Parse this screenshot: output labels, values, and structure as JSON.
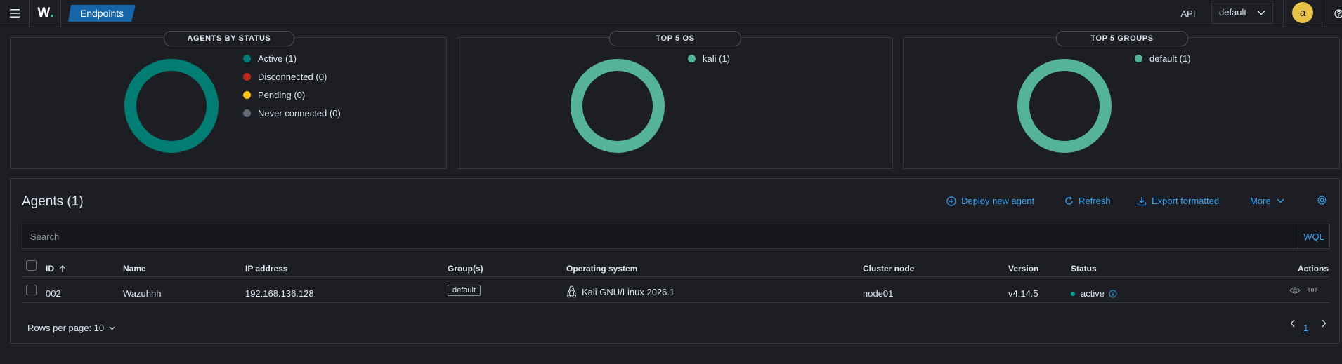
{
  "header": {
    "logo": "W",
    "logo_dot": ".",
    "breadcrumb": "Endpoints",
    "api_label": "API",
    "tenant": "default",
    "avatar_letter": "a"
  },
  "panels": [
    {
      "title": "AGENTS BY STATUS",
      "legend": [
        {
          "label": "Active (1)",
          "color": "#017d73"
        },
        {
          "label": "Disconnected (0)",
          "color": "#bd271e"
        },
        {
          "label": "Pending (0)",
          "color": "#fec514"
        },
        {
          "label": "Never connected (0)",
          "color": "#646a77"
        }
      ],
      "donut_color": "#017d73"
    },
    {
      "title": "TOP 5 OS",
      "legend": [
        {
          "label": "kali (1)",
          "color": "#54b399"
        }
      ],
      "donut_color": "#54b399"
    },
    {
      "title": "TOP 5 GROUPS",
      "legend": [
        {
          "label": "default (1)",
          "color": "#54b399"
        }
      ],
      "donut_color": "#54b399"
    }
  ],
  "agents": {
    "title": "Agents (1)",
    "actions": {
      "deploy": "Deploy new agent",
      "refresh": "Refresh",
      "export": "Export formatted",
      "more": "More"
    },
    "search_placeholder": "Search",
    "wql": "WQL",
    "columns": {
      "id": "ID",
      "name": "Name",
      "ip": "IP address",
      "groups": "Group(s)",
      "os": "Operating system",
      "node": "Cluster node",
      "version": "Version",
      "status": "Status",
      "actions": "Actions"
    },
    "rows": [
      {
        "id": "002",
        "name": "Wazuhhh",
        "ip": "192.168.136.128",
        "group": "default",
        "os": "Kali GNU/Linux 2026.1",
        "node": "node01",
        "version": "v4.14.5",
        "status": "active"
      }
    ],
    "rows_per_page": "Rows per page: 10",
    "page": "1"
  }
}
